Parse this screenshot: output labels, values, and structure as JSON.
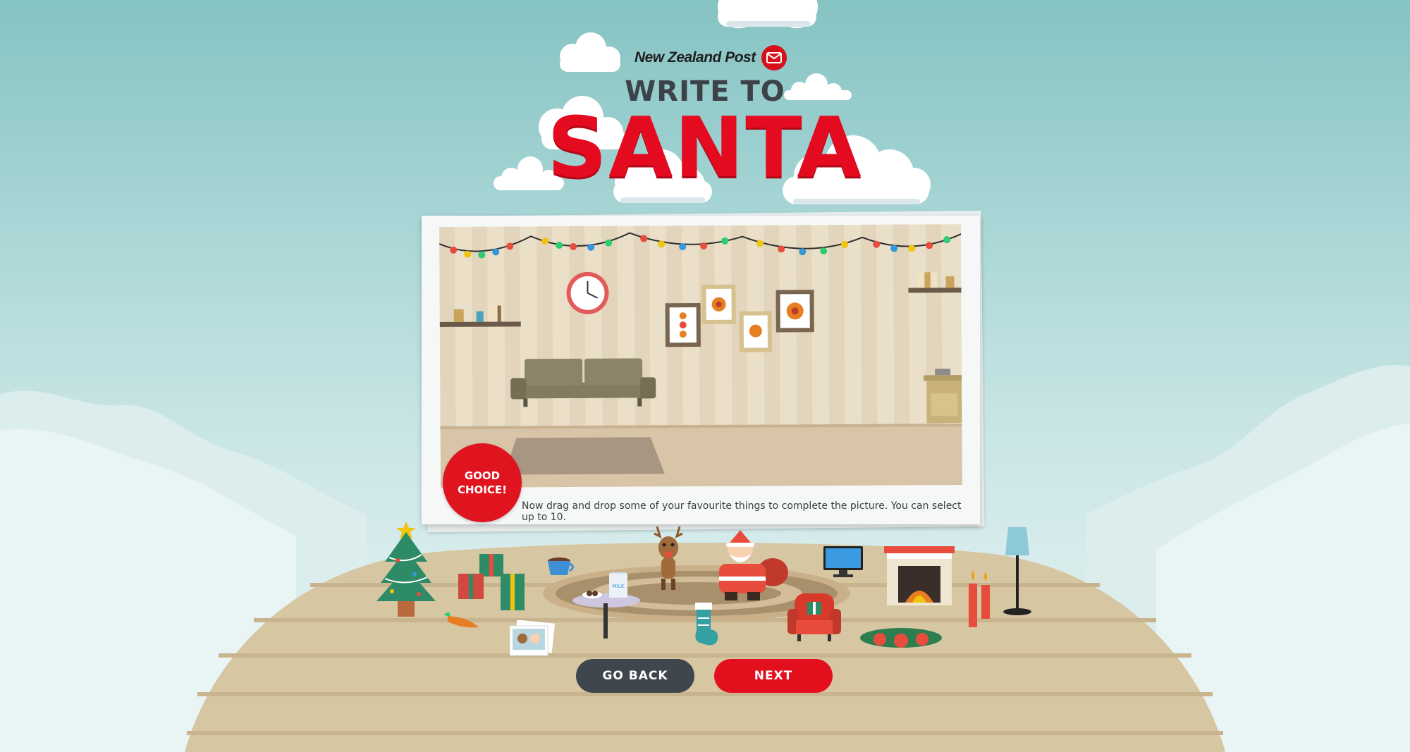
{
  "brand": {
    "name": "New Zealand Post"
  },
  "title": {
    "line1": "WRITE TO",
    "line2": "SANTA"
  },
  "badge": {
    "line1": "GOOD",
    "line2": "CHOICE!"
  },
  "instructions": "Now drag and drop some of your favourite things to complete the picture. You can select up to 10.",
  "buttons": {
    "back": "GO BACK",
    "next": "NEXT"
  },
  "milk_label": "MILK",
  "items": [
    {
      "name": "christmas-tree"
    },
    {
      "name": "presents"
    },
    {
      "name": "coffee-mug"
    },
    {
      "name": "reindeer"
    },
    {
      "name": "santa"
    },
    {
      "name": "tv"
    },
    {
      "name": "fireplace"
    },
    {
      "name": "floor-lamp"
    },
    {
      "name": "candles"
    },
    {
      "name": "milk-and-cookies-table"
    },
    {
      "name": "armchair"
    },
    {
      "name": "stocking"
    },
    {
      "name": "wreath"
    },
    {
      "name": "carrot"
    },
    {
      "name": "photos"
    }
  ],
  "colors": {
    "brand_red": "#e40b20",
    "dark": "#3f464d",
    "sky": "#86c3c3"
  }
}
